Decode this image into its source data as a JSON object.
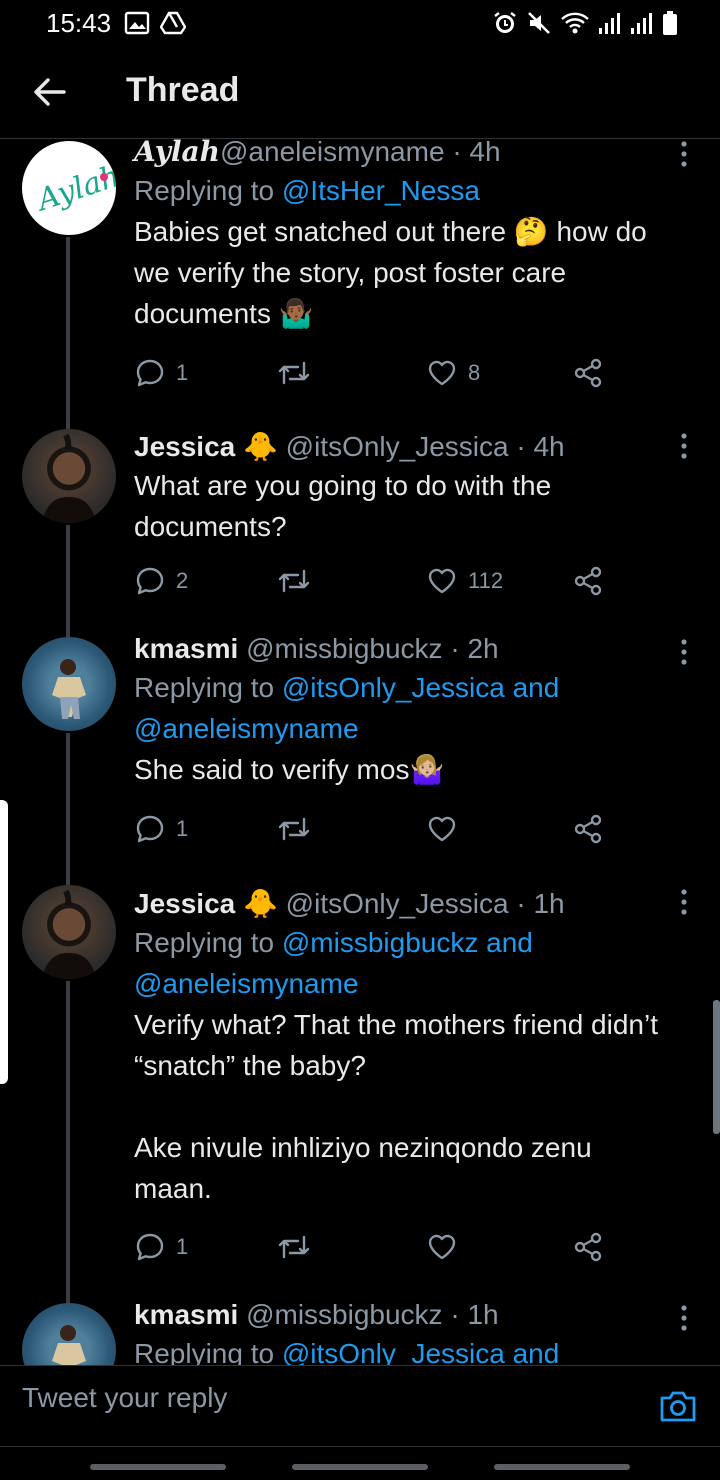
{
  "status": {
    "time": "15:43"
  },
  "header": {
    "title": "Thread"
  },
  "tweets": [
    {
      "name": "Aylah",
      "handle": "@aneleismyname",
      "time": "· 4h",
      "reply_prefix": "Replying to ",
      "reply_to": "@ItsHer_Nessa",
      "text": "Babies get snatched out there 🤔 how do we verify the story, post foster care documents 🤷🏾‍♂️",
      "replies": "1",
      "retweets": "",
      "likes": "8"
    },
    {
      "name": "Jessica 🐥",
      "handle": "@itsOnly_Jessica",
      "time": "· 4h",
      "text": "What are you going to do with the documents?",
      "replies": "2",
      "retweets": "",
      "likes": "112"
    },
    {
      "name": "kmasmi",
      "handle": "@missbigbuckz",
      "time": "· 2h",
      "reply_prefix": "Replying to ",
      "reply_to": "@itsOnly_Jessica and @aneleismyname",
      "text": "She said to verify mos🤷🏼‍♀️",
      "replies": "1",
      "retweets": "",
      "likes": ""
    },
    {
      "name": "Jessica 🐥",
      "handle": "@itsOnly_Jessica",
      "time": "· 1h",
      "reply_prefix": "Replying to ",
      "reply_to": "@missbigbuckz and @aneleismyname",
      "text": "Verify what? That the mothers friend didn’t “snatch” the baby?\n\nAke nivule inhliziyo nezinqondo zenu maan.",
      "replies": "1",
      "retweets": "",
      "likes": ""
    },
    {
      "name": "kmasmi",
      "handle": "@missbigbuckz",
      "time": "· 1h",
      "reply_prefix": "Replying to ",
      "reply_to": "@itsOnly_Jessica and"
    }
  ],
  "composer": {
    "placeholder": "Tweet your reply"
  },
  "icons": {
    "back": "arrow-left-icon",
    "reply": "reply-icon",
    "retweet": "retweet-icon",
    "like": "heart-icon",
    "share": "share-icon",
    "more": "more-vertical-icon",
    "camera": "camera-icon"
  },
  "colors": {
    "accent": "#1d9bf0",
    "text": "#e7e9ea",
    "muted": "#8b98a5",
    "background": "#000000"
  }
}
